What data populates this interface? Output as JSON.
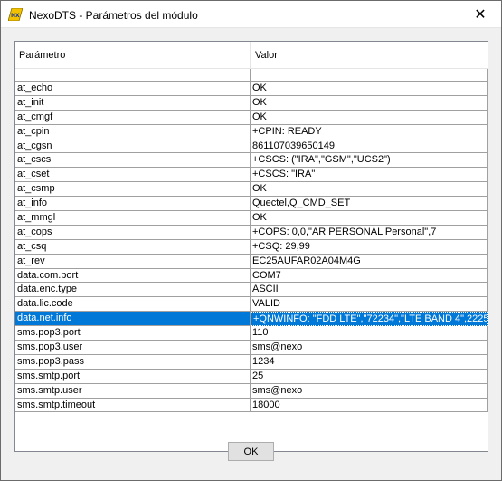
{
  "window": {
    "title": "NexoDTS - Parámetros del módulo",
    "app_icon": "nexo-logo-icon",
    "close_icon": "close-icon",
    "close_glyph": "✕"
  },
  "table": {
    "columns": [
      "Parámetro",
      "Valor"
    ],
    "rows": [
      {
        "param": "at_echo",
        "value": "OK"
      },
      {
        "param": "at_init",
        "value": "OK"
      },
      {
        "param": "at_cmgf",
        "value": "OK"
      },
      {
        "param": "at_cpin",
        "value": "+CPIN: READY"
      },
      {
        "param": "at_cgsn",
        "value": "861107039650149"
      },
      {
        "param": "at_cscs",
        "value": "+CSCS: (\"IRA\",\"GSM\",\"UCS2\")"
      },
      {
        "param": "at_cset",
        "value": "+CSCS: \"IRA\""
      },
      {
        "param": "at_csmp",
        "value": "OK"
      },
      {
        "param": "at_info",
        "value": "Quectel,Q_CMD_SET"
      },
      {
        "param": "at_mmgl",
        "value": "OK"
      },
      {
        "param": "at_cops",
        "value": "+COPS: 0,0,\"AR PERSONAL Personal\",7"
      },
      {
        "param": "at_csq",
        "value": "+CSQ: 29,99"
      },
      {
        "param": "at_rev",
        "value": "EC25AUFAR02A04M4G"
      },
      {
        "param": "data.com.port",
        "value": "COM7"
      },
      {
        "param": "data.enc.type",
        "value": "ASCII"
      },
      {
        "param": "data.lic.code",
        "value": "VALID"
      },
      {
        "param": "data.net.info",
        "value": "+QNWINFO: \"FDD LTE\",\"72234\",\"LTE BAND 4\",2225"
      },
      {
        "param": "sms.pop3.port",
        "value": "110"
      },
      {
        "param": "sms.pop3.user",
        "value": "sms@nexo"
      },
      {
        "param": "sms.pop3.pass",
        "value": "1234"
      },
      {
        "param": "sms.smtp.port",
        "value": "25"
      },
      {
        "param": "sms.smtp.user",
        "value": "sms@nexo"
      },
      {
        "param": "sms.smtp.timeout",
        "value": "18000"
      }
    ],
    "selected_param": "data.net.info"
  },
  "footer": {
    "ok_label": "OK"
  },
  "colors": {
    "selection": "#0078d7",
    "grid_line": "#a0a0a0"
  }
}
